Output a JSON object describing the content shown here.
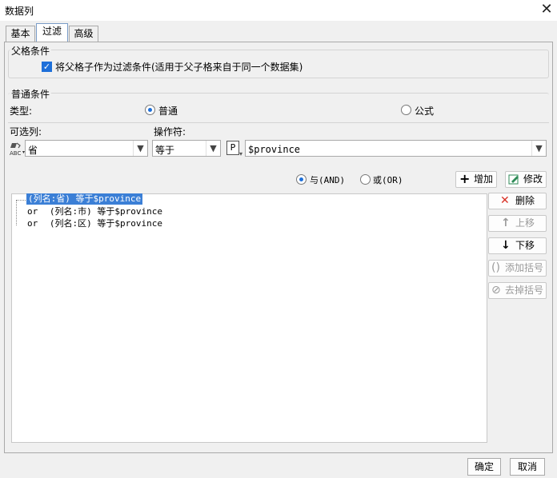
{
  "window": {
    "title": "数据列",
    "close_glyph": "✕"
  },
  "tabs": [
    {
      "label": "基本",
      "active": false
    },
    {
      "label": "过滤",
      "active": true
    },
    {
      "label": "高级",
      "active": false
    }
  ],
  "parent_condition": {
    "title": "父格条件",
    "checkbox_label": "将父格子作为过滤条件(适用于父子格来自于同一个数据集)",
    "checked": true
  },
  "normal_condition": {
    "title": "普通条件",
    "type_label": "类型:",
    "type_options": [
      {
        "label": "普通",
        "selected": true
      },
      {
        "label": "公式",
        "selected": false
      }
    ],
    "column_label": "可选列:",
    "operator_label": "操作符:",
    "column_value": "省",
    "column_icon": "abc-field-icon",
    "operator_value": "等于",
    "param_icon_letter": "P",
    "param_value": "$province"
  },
  "logic": {
    "and_label": "与(AND)",
    "or_label": "或(OR)",
    "and_selected": true
  },
  "actions": {
    "add_label": "增加",
    "modify_label": "修改",
    "delete_label": "删除",
    "move_up_label": "上移",
    "move_down_label": "下移",
    "add_bracket_label": "添加括号",
    "remove_bracket_label": "去掉括号"
  },
  "conditions": [
    {
      "prefix": "",
      "text": "(列名:省) 等于$province",
      "selected": true
    },
    {
      "prefix": "or",
      "text": "(列名:市) 等于$province",
      "selected": false
    },
    {
      "prefix": "or",
      "text": "(列名:区) 等于$province",
      "selected": false
    }
  ],
  "footer": {
    "ok_label": "确定",
    "cancel_label": "取消"
  },
  "colors": {
    "accent": "#1e6fd9",
    "selection": "#3b7fd6",
    "delete_red": "#d93025"
  }
}
